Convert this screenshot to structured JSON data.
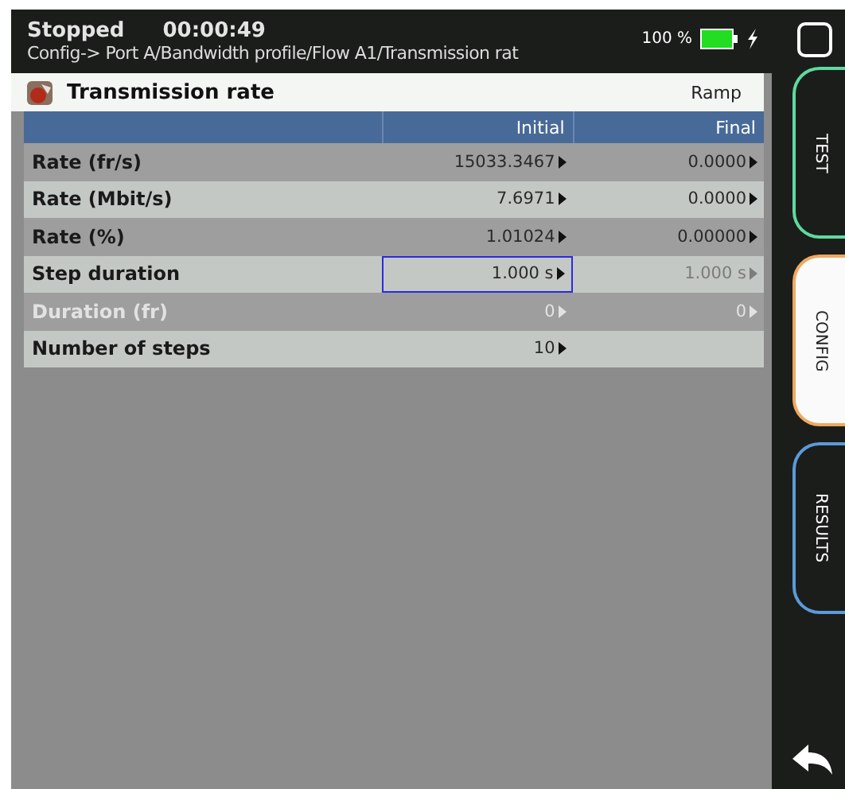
{
  "status": {
    "state": "Stopped",
    "time": "00:00:49",
    "breadcrumb": "Config-> Port A/Bandwidth profile/Flow A1/Transmission rat",
    "battery_text": "100 %",
    "charging": true
  },
  "panel": {
    "title": "Transmission rate",
    "mode": "Ramp"
  },
  "table": {
    "columns": [
      "Initial",
      "Final"
    ],
    "rows": [
      {
        "label": "Rate (fr/s)",
        "disabled": false,
        "cells": [
          {
            "value": "15033.3467",
            "disabled": false,
            "focused": false
          },
          {
            "value": "0.0000",
            "disabled": false,
            "focused": false
          }
        ]
      },
      {
        "label": "Rate (Mbit/s)",
        "disabled": false,
        "cells": [
          {
            "value": "7.6971",
            "disabled": false,
            "focused": false
          },
          {
            "value": "0.0000",
            "disabled": false,
            "focused": false
          }
        ]
      },
      {
        "label": "Rate (%)",
        "disabled": false,
        "cells": [
          {
            "value": "1.01024",
            "disabled": false,
            "focused": false
          },
          {
            "value": "0.00000",
            "disabled": false,
            "focused": false
          }
        ]
      },
      {
        "label": "Step duration",
        "disabled": false,
        "cells": [
          {
            "value": "1.000 s",
            "disabled": false,
            "focused": true
          },
          {
            "value": "1.000 s",
            "disabled": true,
            "focused": false
          }
        ]
      },
      {
        "label": "Duration (fr)",
        "disabled": true,
        "cells": [
          {
            "value": "0",
            "disabled": true,
            "focused": false
          },
          {
            "value": "0",
            "disabled": true,
            "focused": false
          }
        ]
      },
      {
        "label": "Number of steps",
        "disabled": false,
        "cells": [
          {
            "value": "10",
            "disabled": false,
            "focused": false
          }
        ]
      }
    ]
  },
  "side_tabs": [
    {
      "label": "TEST",
      "selected": false,
      "color": "#5fd9a0"
    },
    {
      "label": "CONFIG",
      "selected": true,
      "color": "#f0a860"
    },
    {
      "label": "RESULTS",
      "selected": false,
      "color": "#5b9bd9"
    }
  ]
}
